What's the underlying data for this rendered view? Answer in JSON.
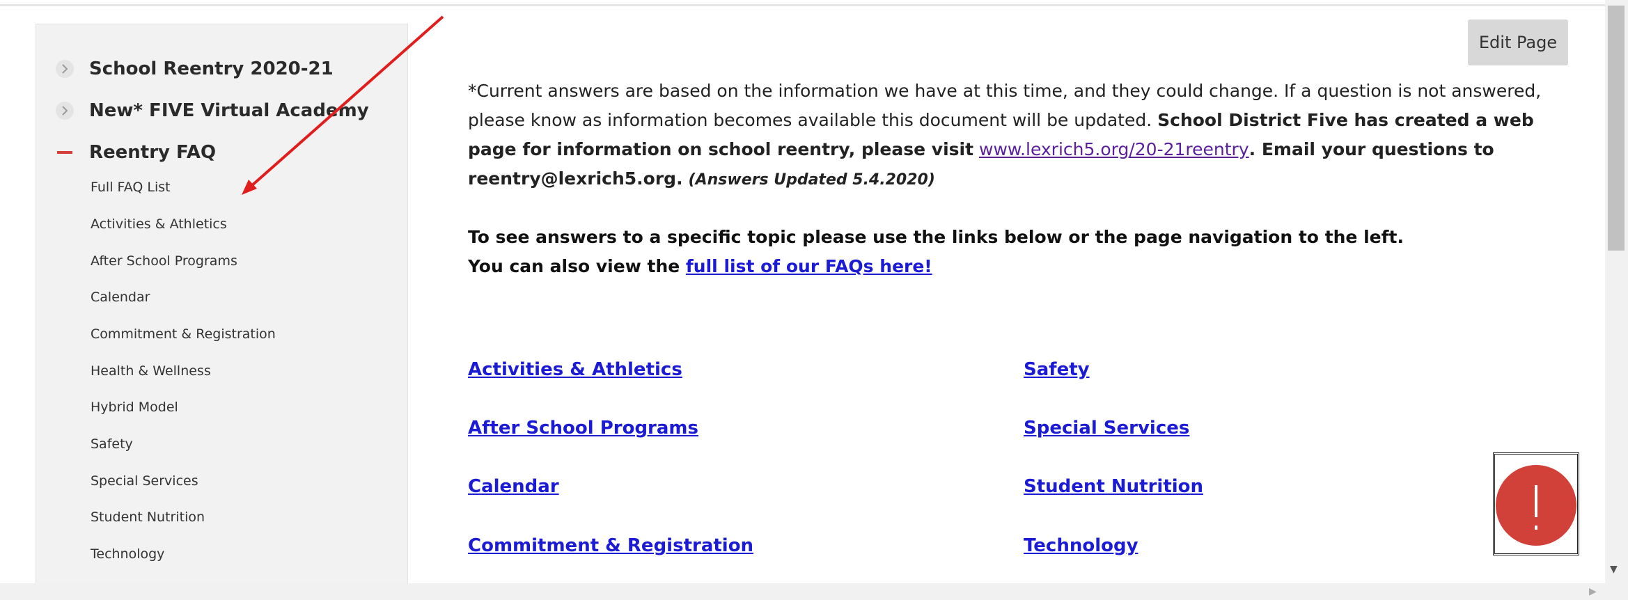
{
  "edit_button": "Edit Page",
  "sidebar": {
    "top_items": [
      {
        "label": "School Reentry 2020-21"
      },
      {
        "label": "New* FIVE Virtual Academy"
      },
      {
        "label": "Reentry FAQ"
      }
    ],
    "sub_items": [
      "Full FAQ List",
      "Activities & Athletics",
      "After School Programs",
      "Calendar",
      "Commitment & Registration",
      "Health & Wellness",
      "Hybrid Model",
      "Safety",
      "Special Services",
      "Student Nutrition",
      "Technology"
    ]
  },
  "main": {
    "intro_normal": "*Current answers are based on the information we have at this time, and they could change. If a question is not answered, please know as information becomes available this document will be updated.",
    "intro_bold_1": "School District Five has created a web page for information on school reentry, please visit",
    "intro_link": "www.lexrich5.org/20-21reentry",
    "intro_bold_2": ". Email your questions to reentry@lexrich5.org.",
    "intro_italic": "(Answers Updated 5.4.2020)",
    "topics_line": "To see answers to a specific topic please use the links below or the page navigation to the left.",
    "full_list_prefix": "You can also view the",
    "full_list_link": "full list of our FAQs here!",
    "left_links": [
      "Activities & Athletics",
      "After School Programs",
      "Calendar",
      "Commitment & Registration"
    ],
    "right_links": [
      "Safety",
      "Special Services",
      "Student Nutrition",
      "Technology"
    ]
  },
  "alert_icon": "exclamation-icon",
  "colors": {
    "link": "#1b1bd6",
    "visited_link": "#5a1f9a",
    "alert": "#d2403a",
    "arrow": "#e01e1e",
    "minus": "#d2403a"
  }
}
